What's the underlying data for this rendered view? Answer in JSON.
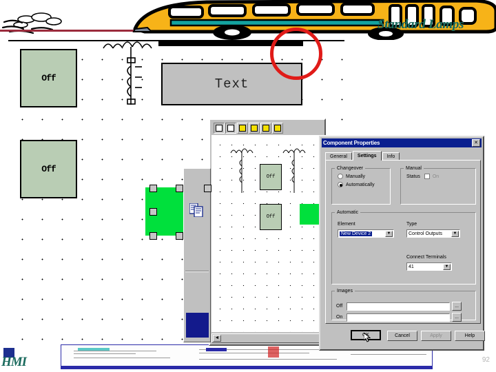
{
  "slide": {
    "title": "Standard Lamps",
    "page_number": "92",
    "logo_text": "HMI",
    "accent_color": "#1b6b5e",
    "annotation_circle_color": "#e01b18"
  },
  "canvas": {
    "lamp1_label": "Off",
    "lamp2_label": "Off",
    "textbox_label": "Text",
    "lamp_fill_color": "#b9cdb4",
    "selected_object_color": "#00e03c"
  },
  "background_window": {
    "toolbar_icons": [
      "align-left-icon",
      "align-right-icon",
      "bring-to-front-icon",
      "send-to-back-icon",
      "bring-forward-icon",
      "send-backward-icon"
    ],
    "mini_lamp_label": "Off",
    "scroll_left_arrow": "◄"
  },
  "palette": {
    "copy_icon": "copy-documents-icon"
  },
  "dialog": {
    "title": "Component Properties",
    "close_label": "✕",
    "tabs": [
      {
        "label": "General",
        "active": false
      },
      {
        "label": "Settings",
        "active": true
      },
      {
        "label": "Info",
        "active": false
      }
    ],
    "changeover": {
      "legend": "Changeover",
      "options": [
        {
          "label": "Manually",
          "selected": false
        },
        {
          "label": "Automatically",
          "selected": true
        }
      ]
    },
    "manual": {
      "legend": "Manual",
      "status_label": "Status",
      "on_label": "On",
      "on_checked": false
    },
    "automatic": {
      "legend": "Automatic",
      "element_label": "Element",
      "element_value": "New Device 2",
      "type_label": "Type",
      "type_value": "Control Outputs",
      "terminals_label": "Connect Terminals",
      "terminals_value": "41",
      "dropdown_arrow": "▼"
    },
    "images": {
      "legend": "Images",
      "off_label": "Off",
      "off_value": "",
      "on_label": "On",
      "on_value": "",
      "browse_label": "..."
    },
    "buttons": [
      {
        "label": "OK",
        "style": "default"
      },
      {
        "label": "Cancel",
        "style": "normal"
      },
      {
        "label": "Apply",
        "style": "disabled"
      },
      {
        "label": "Help",
        "style": "normal"
      }
    ]
  }
}
